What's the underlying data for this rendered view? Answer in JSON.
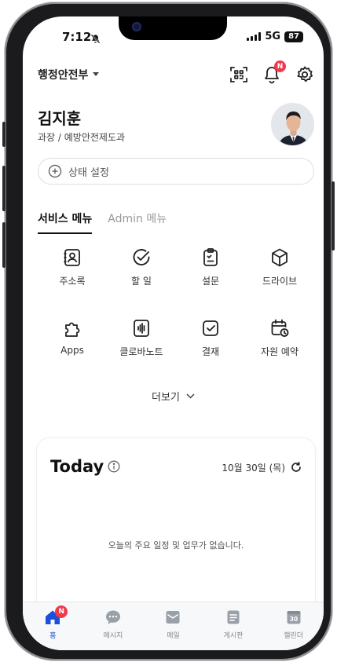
{
  "status_bar": {
    "time": "7:12",
    "network": "5G",
    "battery": "87"
  },
  "header": {
    "org_name": "행정안전부",
    "notification_badge": "N"
  },
  "profile": {
    "name": "김지훈",
    "department": "과장 / 예방안전제도과"
  },
  "status_field": {
    "placeholder": "상태 설정"
  },
  "tabs": [
    {
      "label": "서비스 메뉴",
      "active": true
    },
    {
      "label": "Admin 메뉴",
      "active": false
    }
  ],
  "services": [
    {
      "label": "주소록",
      "icon": "address-book-icon"
    },
    {
      "label": "할 일",
      "icon": "check-circle-icon"
    },
    {
      "label": "설문",
      "icon": "clipboard-icon"
    },
    {
      "label": "드라이브",
      "icon": "cube-icon"
    },
    {
      "label": "Apps",
      "icon": "puzzle-icon"
    },
    {
      "label": "클로바노트",
      "icon": "voice-note-icon"
    },
    {
      "label": "결재",
      "icon": "approval-icon"
    },
    {
      "label": "자원 예약",
      "icon": "calendar-clock-icon"
    }
  ],
  "more": {
    "label": "더보기"
  },
  "today": {
    "title": "Today",
    "date": "10월 30일 (목)",
    "empty_message": "오늘의 주요 일정 및 업무가 없습니다."
  },
  "bottom_nav": [
    {
      "label": "홈",
      "icon": "home-icon",
      "active": true,
      "badge": "N"
    },
    {
      "label": "메시지",
      "icon": "message-icon",
      "active": false
    },
    {
      "label": "메일",
      "icon": "mail-icon",
      "active": false
    },
    {
      "label": "게시판",
      "icon": "board-icon",
      "active": false
    },
    {
      "label": "캘린더",
      "icon": "calendar-icon",
      "active": false,
      "day": "30"
    }
  ],
  "colors": {
    "accent": "#1d4fd8",
    "badge": "#ef3a4b"
  }
}
